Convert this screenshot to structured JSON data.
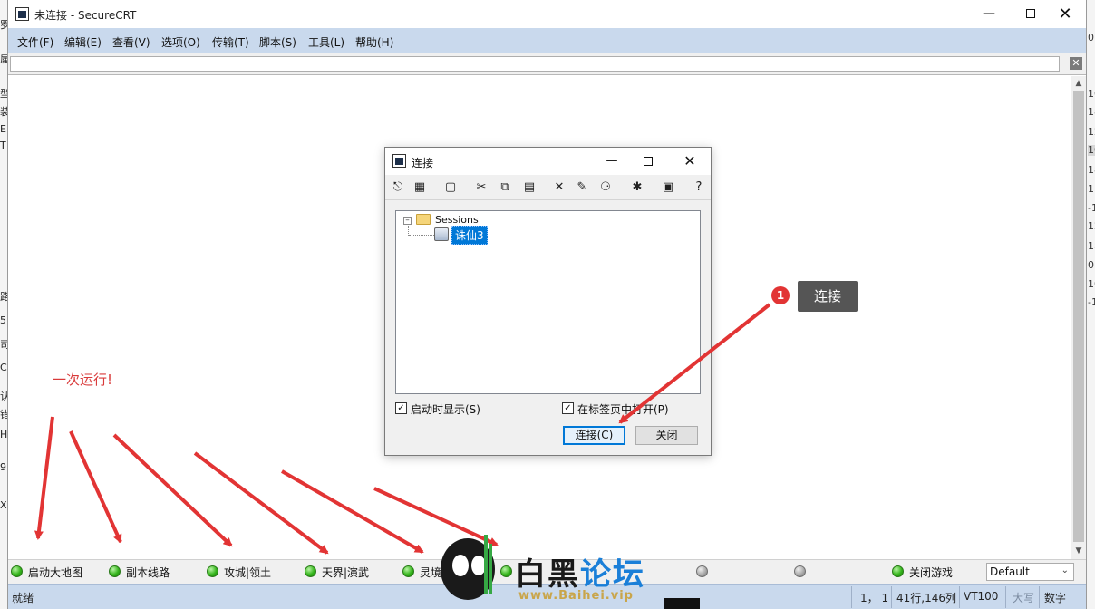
{
  "window": {
    "title": "未连接 - SecureCRT"
  },
  "menu": [
    "文件(F)",
    "编辑(E)",
    "查看(V)",
    "选项(O)",
    "传输(T)",
    "脚本(S)",
    "工具(L)",
    "帮助(H)"
  ],
  "dialog": {
    "title": "连接",
    "tree_root": "Sessions",
    "session": "诛仙3",
    "chk_startup": "启动时显示(S)",
    "chk_tab": "在标签页中打开(P)",
    "btn_connect": "连接(C)",
    "btn_close": "关闭"
  },
  "button_bar": {
    "items": [
      "启动大地图",
      "副本线路",
      "攻城|领土",
      "天界|演武",
      "灵境副本",
      "",
      "",
      "",
      "",
      "关闭游戏"
    ],
    "session_select": "Default"
  },
  "status": {
    "ready": "就绪",
    "pos": "1，  1",
    "size": "41行,146列",
    "term": "VT100",
    "caps": "大写",
    "num": "数字"
  },
  "annotations": {
    "step_number": "1",
    "step_label": "连接",
    "note": "一次运行!"
  },
  "watermark": {
    "brand_black": "白黑",
    "brand_blue": "论坛",
    "url": "www.Baihei.vip"
  },
  "colors": {
    "menubar": "#c9d9ed",
    "arrow": "#e23434",
    "selection": "#0078d7"
  }
}
